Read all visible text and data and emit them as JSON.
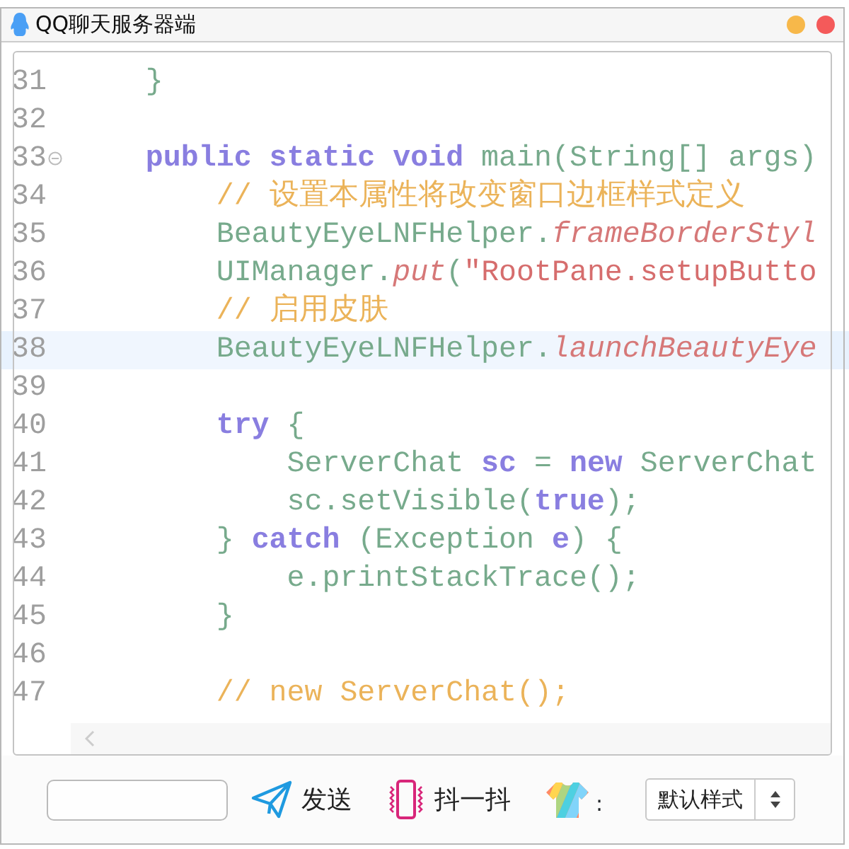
{
  "window": {
    "title": "QQ聊天服务器端"
  },
  "background_editor": {
    "lines": [
      {
        "number": "31",
        "current": false,
        "parts": [
          {
            "kind": "plain",
            "text": "    }"
          }
        ]
      },
      {
        "number": "32",
        "current": false
      },
      {
        "number": "33",
        "current": false,
        "fold_marker": true,
        "parts": [
          {
            "kind": "keyword",
            "text": "    public static void "
          },
          {
            "kind": "plain",
            "text": "main(String[] args)"
          }
        ]
      },
      {
        "number": "34",
        "current": false,
        "parts": [
          {
            "kind": "comment",
            "text": "        // 设置本属性将改变窗口边框样式定义"
          }
        ]
      },
      {
        "number": "35",
        "current": false,
        "parts": [
          {
            "kind": "plain",
            "text": "        BeautyEyeLNFHelper."
          },
          {
            "kind": "method",
            "text": "frameBorderStyl"
          }
        ]
      },
      {
        "number": "36",
        "current": false,
        "parts": [
          {
            "kind": "plain",
            "text": "        UIManager."
          },
          {
            "kind": "method",
            "text": "put"
          },
          {
            "kind": "plain",
            "text": "("
          },
          {
            "kind": "string",
            "text": "\"RootPane.setupButto"
          }
        ]
      },
      {
        "number": "37",
        "current": false,
        "parts": [
          {
            "kind": "comment",
            "text": "        // 启用皮肤"
          }
        ]
      },
      {
        "number": "38",
        "current": true,
        "parts": [
          {
            "kind": "plain",
            "text": "        BeautyEyeLNFHelper."
          },
          {
            "kind": "method",
            "text": "launchBeautyEye"
          }
        ]
      },
      {
        "number": "39",
        "current": false
      },
      {
        "number": "40",
        "current": false,
        "parts": [
          {
            "kind": "keyword",
            "text": "        try "
          },
          {
            "kind": "plain",
            "text": "{"
          }
        ]
      },
      {
        "number": "41",
        "current": false,
        "parts": [
          {
            "kind": "plain",
            "text": "            ServerChat "
          },
          {
            "kind": "keyword",
            "text": "sc"
          },
          {
            "kind": "plain",
            "text": " = "
          },
          {
            "kind": "keyword",
            "text": "new "
          },
          {
            "kind": "plain",
            "text": "ServerChat"
          }
        ]
      },
      {
        "number": "42",
        "current": false,
        "parts": [
          {
            "kind": "plain",
            "text": "            sc.setVisible("
          },
          {
            "kind": "keyword",
            "text": "true"
          },
          {
            "kind": "plain",
            "text": ");"
          }
        ]
      },
      {
        "number": "43",
        "current": false,
        "parts": [
          {
            "kind": "plain",
            "text": "        } "
          },
          {
            "kind": "keyword",
            "text": "catch "
          },
          {
            "kind": "plain",
            "text": "(Exception "
          },
          {
            "kind": "keyword",
            "text": "e"
          },
          {
            "kind": "plain",
            "text": ") {"
          }
        ]
      },
      {
        "number": "44",
        "current": false,
        "parts": [
          {
            "kind": "plain",
            "text": "            e.printStackTrace();"
          }
        ]
      },
      {
        "number": "45",
        "current": false,
        "parts": [
          {
            "kind": "plain",
            "text": "        }"
          }
        ]
      },
      {
        "number": "46",
        "current": false
      },
      {
        "number": "47",
        "current": false,
        "parts": [
          {
            "kind": "comment",
            "text": "        // new ServerChat();"
          }
        ]
      }
    ]
  },
  "toolbar": {
    "buttons": [
      {
        "kind": "send",
        "label": "发送"
      },
      {
        "kind": "shake",
        "label": "抖一抖"
      }
    ],
    "theme": {
      "label": ":"
    },
    "style_select": {
      "value": "默认样式"
    }
  }
}
